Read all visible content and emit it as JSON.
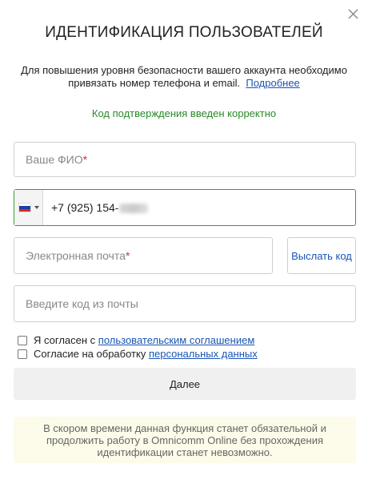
{
  "dialog": {
    "title": "ИДЕНТИФИКАЦИЯ ПОЛЬЗОВАТЕЛЕЙ",
    "description": "Для повышения уровня безопасности вашего аккаунта необходимо привязать номер телефона и email.",
    "more_link": "Подробнее",
    "success_message": "Код подтверждения введен корректно"
  },
  "form": {
    "name_placeholder": "Ваше ФИО",
    "required_mark": "*",
    "phone": {
      "country": "ru",
      "value": "+7 (925) 154-"
    },
    "email_placeholder": "Электронная почта",
    "send_code_label": "Выслать код",
    "code_placeholder": "Введите код из почты"
  },
  "consents": [
    {
      "text": "Я согласен с",
      "link": "пользовательским соглашением",
      "checked": false
    },
    {
      "text": "Согласие на обработку",
      "link": "персональных данных",
      "checked": false
    }
  ],
  "next_label": "Далее",
  "notice": "В скором времени данная функция станет обязательной и продолжить работу в Omnicomm Online без прохождения идентификации станет невозможно.",
  "colors": {
    "link": "#1a55b4",
    "success": "#2a8a2a",
    "required": "#d32f2f",
    "active_border": "#3c9a3c",
    "notice_bg": "#fdfbe9"
  }
}
